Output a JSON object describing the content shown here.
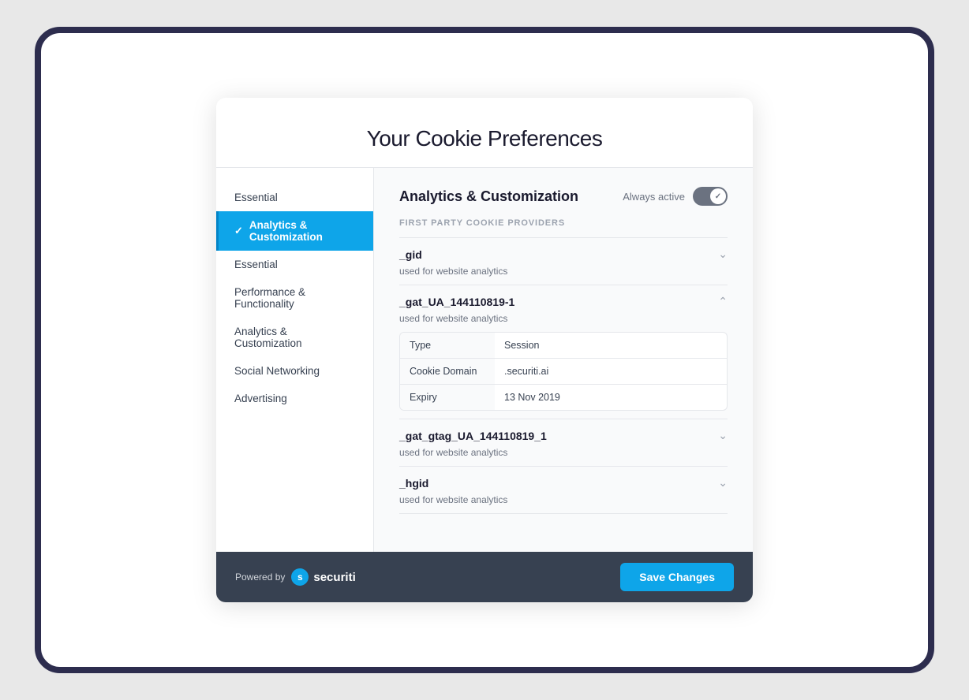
{
  "page": {
    "title": "Your Cookie Preferences"
  },
  "sidebar": {
    "items": [
      {
        "id": "essential-top",
        "label": "Essential",
        "active": false
      },
      {
        "id": "analytics-customization",
        "label": "Analytics & Customization",
        "active": true
      },
      {
        "id": "essential",
        "label": "Essential",
        "active": false
      },
      {
        "id": "performance-functionality",
        "label": "Performance & Functionality",
        "active": false
      },
      {
        "id": "analytics-customization-2",
        "label": "Analytics & Customization",
        "active": false
      },
      {
        "id": "social-networking",
        "label": "Social Networking",
        "active": false
      },
      {
        "id": "advertising",
        "label": "Advertising",
        "active": false
      }
    ]
  },
  "main": {
    "section_title": "Analytics & Customization",
    "always_active_label": "Always active",
    "providers_label": "FIRST PARTY COOKIE PROVIDERS",
    "cookies": [
      {
        "id": "gid",
        "name": "_gid",
        "description": "used for website analytics",
        "expanded": false,
        "details": []
      },
      {
        "id": "gat-ua",
        "name": "_gat_UA_144110819-1",
        "description": "used for website analytics",
        "expanded": true,
        "details": [
          {
            "label": "Type",
            "value": "Session"
          },
          {
            "label": "Cookie Domain",
            "value": ".securiti.ai"
          },
          {
            "label": "Expiry",
            "value": "13 Nov 2019"
          }
        ]
      },
      {
        "id": "gat-gtag",
        "name": "_gat_gtag_UA_144110819_1",
        "description": "used for website analytics",
        "expanded": false,
        "details": []
      },
      {
        "id": "hgid",
        "name": "_hgid",
        "description": "used for website analytics",
        "expanded": false,
        "details": []
      }
    ]
  },
  "footer": {
    "powered_by_label": "Powered by",
    "brand_name": "securiti",
    "save_button_label": "Save Changes"
  }
}
